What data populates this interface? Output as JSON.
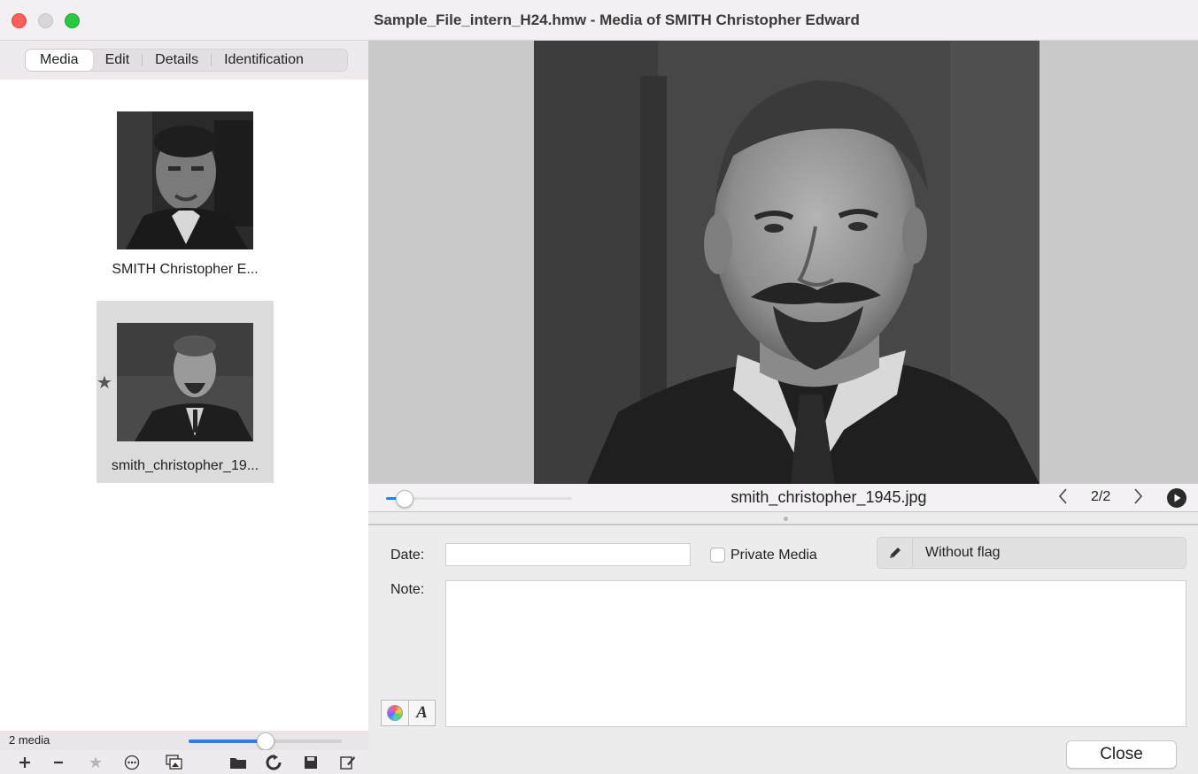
{
  "window": {
    "title": "Sample_File_intern_H24.hmw - Media of SMITH Christopher Edward"
  },
  "tabs": [
    {
      "label": "Media",
      "active": true
    },
    {
      "label": "Edit",
      "active": false
    },
    {
      "label": "Details",
      "active": false
    },
    {
      "label": "Identification",
      "active": false
    }
  ],
  "media_list": {
    "items": [
      {
        "label": "SMITH Christopher E...",
        "selected": false,
        "starred": false
      },
      {
        "label": "smith_christopher_19...",
        "selected": true,
        "starred": true
      }
    ],
    "count_label": "2 media",
    "thumbnail_zoom": 0.5
  },
  "toolbar": {
    "buttons": [
      "add-icon",
      "remove-icon",
      "star-icon",
      "more-icon",
      "gallery-icon",
      "folder-icon",
      "refresh-icon",
      "save-icon",
      "edit-icon"
    ]
  },
  "viewer": {
    "filename": "smith_christopher_1945.jpg",
    "page_indicator": "2/2",
    "zoom_level": 0.1
  },
  "details": {
    "date_label": "Date:",
    "date_value": "",
    "private_label": "Private Media",
    "private_checked": false,
    "flag_label": "Without flag",
    "note_label": "Note:",
    "note_value": "",
    "close_label": "Close"
  },
  "colors": {
    "accent": "#2f7bf6",
    "viewer_background": "#c9c9c9",
    "close_traffic": "#fe5f57",
    "maximize_traffic": "#28c840"
  }
}
